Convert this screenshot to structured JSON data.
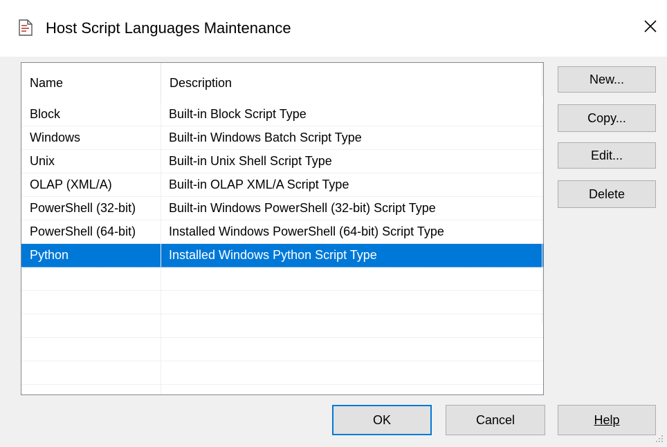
{
  "window": {
    "title": "Host Script Languages Maintenance",
    "icon": "document-script-icon",
    "close_icon": "close-icon"
  },
  "list": {
    "columns": [
      "Name",
      "Description"
    ],
    "rows": [
      {
        "name": "Block",
        "description": "Built-in Block Script Type"
      },
      {
        "name": "Windows",
        "description": "Built-in Windows Batch Script Type"
      },
      {
        "name": "Unix",
        "description": "Built-in Unix Shell Script Type"
      },
      {
        "name": "OLAP (XML/A)",
        "description": "Built-in OLAP XML/A Script Type"
      },
      {
        "name": "PowerShell (32-bit)",
        "description": "Built-in Windows PowerShell (32-bit) Script Type"
      },
      {
        "name": "PowerShell (64-bit)",
        "description": "Installed Windows PowerShell (64-bit) Script Type"
      },
      {
        "name": "Python",
        "description": "Installed Windows Python Script Type"
      }
    ],
    "selected_row": "Python"
  },
  "side_buttons": {
    "new": "New...",
    "copy": "Copy...",
    "edit": "Edit...",
    "delete": "Delete"
  },
  "bottom_buttons": {
    "ok": "OK",
    "cancel": "Cancel",
    "help": "Help"
  },
  "colors": {
    "selection": "#0078d7",
    "button_face": "#e1e1e1",
    "dialog_bg": "#f0f0f0"
  }
}
